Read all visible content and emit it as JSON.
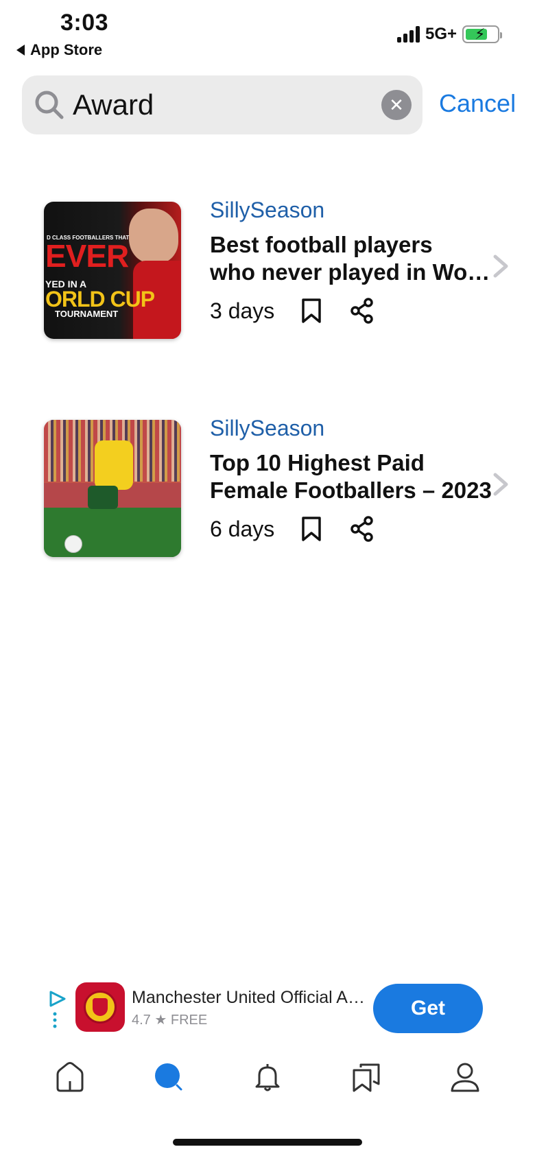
{
  "status_bar": {
    "time": "3:03",
    "back_label": "App Store",
    "network": "5G+"
  },
  "search": {
    "query": "Award",
    "cancel_label": "Cancel"
  },
  "results": [
    {
      "source": "SillySeason",
      "title_line1": "Best football players",
      "title_line2": "who never played in World Cup",
      "age": "3 days",
      "thumb_text": {
        "small": "D CLASS FOOTBALLERS THAT",
        "big": "EVER",
        "mid": "YED IN A",
        "cup": "ORLD CUP",
        "bottom": "TOURNAMENT"
      }
    },
    {
      "source": "SillySeason",
      "title_line1": "Top 10 Highest Paid",
      "title_line2": "Female Footballers – 2023",
      "age": "6 days"
    }
  ],
  "ad": {
    "app_name": "Manchester United Official App",
    "rating": "4.7",
    "price": "FREE",
    "get_label": "Get"
  },
  "colors": {
    "accent": "#1a7ae0",
    "source_link": "#1f5fa8",
    "search_bg": "#ebebeb"
  },
  "tabs": [
    "home-icon",
    "search-icon",
    "bell-icon",
    "bookmarks-icon",
    "profile-icon"
  ]
}
